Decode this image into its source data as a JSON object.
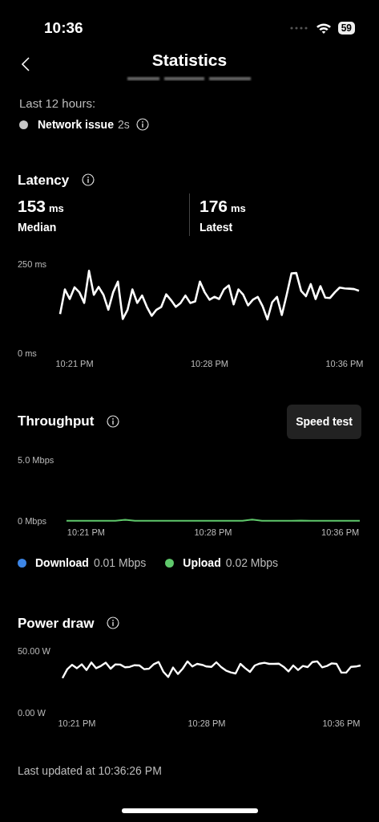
{
  "status_bar": {
    "time": "10:36",
    "battery": "59"
  },
  "header": {
    "title": "Statistics"
  },
  "summary": {
    "period": "Last 12 hours:",
    "events": [
      {
        "label": "Network issue",
        "duration": "2s",
        "color": "#c8c8c8"
      }
    ]
  },
  "latency": {
    "title": "Latency",
    "stats": [
      {
        "value": "153",
        "unit": "ms",
        "label": "Median"
      },
      {
        "value": "176",
        "unit": "ms",
        "label": "Latest"
      }
    ],
    "chart_data": {
      "type": "line",
      "ylim": [
        0,
        250
      ],
      "yticks": [
        {
          "value": 0,
          "label": "0 ms"
        },
        {
          "value": 250,
          "label": "250 ms"
        }
      ],
      "categories": [
        null,
        null,
        null,
        "10:21 PM",
        null,
        null,
        null,
        null,
        null,
        null,
        null,
        null,
        null,
        null,
        null,
        null,
        null,
        null,
        null,
        null,
        null,
        null,
        null,
        null,
        null,
        null,
        null,
        null,
        null,
        null,
        null,
        "10:28 PM",
        null,
        null,
        null,
        null,
        null,
        null,
        null,
        null,
        null,
        null,
        null,
        null,
        null,
        null,
        null,
        null,
        null,
        null,
        null,
        null,
        null,
        null,
        null,
        null,
        null,
        null,
        null,
        "10:36 PM",
        null,
        null,
        null
      ],
      "series": [
        {
          "color": "#ffffff",
          "values": [
            110,
            179,
            152,
            185,
            171,
            141,
            231,
            164,
            186,
            164,
            122,
            171,
            201,
            96,
            122,
            179,
            141,
            162,
            130,
            105,
            122,
            130,
            165,
            149,
            130,
            141,
            162,
            141,
            145,
            201,
            171,
            150,
            158,
            152,
            179,
            190,
            137,
            179,
            164,
            134,
            150,
            158,
            132,
            95,
            143,
            158,
            107,
            164,
            224,
            225,
            175,
            160,
            194,
            152,
            188,
            156,
            155,
            171,
            184,
            182,
            181,
            180,
            175
          ]
        }
      ]
    }
  },
  "throughput": {
    "title": "Throughput",
    "button": "Speed test",
    "chart_data": {
      "type": "line",
      "ylim": [
        0,
        5
      ],
      "yticks": [
        {
          "value": 0,
          "label": "0 Mbps"
        },
        {
          "value": 5,
          "label": "5.0 Mbps"
        }
      ],
      "categories": [
        null,
        null,
        "10:21 PM",
        null,
        null,
        null,
        null,
        null,
        null,
        null,
        null,
        null,
        null,
        null,
        null,
        "10:28 PM",
        null,
        null,
        null,
        null,
        null,
        null,
        null,
        null,
        null,
        null,
        null,
        null,
        "10:36 PM",
        null,
        null
      ],
      "series": [
        {
          "color": "#5fc86b",
          "values": [
            0.02,
            0.02,
            0.02,
            0.02,
            0.02,
            0.02,
            0.1,
            0.02,
            0.02,
            0.02,
            0.02,
            0.02,
            0.02,
            0.02,
            0.02,
            0.02,
            0.02,
            0.02,
            0.02,
            0.12,
            0.02,
            0.02,
            0.02,
            0.02,
            0.03,
            0.02,
            0.02,
            0.02,
            0.02,
            0.02,
            0.02
          ]
        }
      ]
    },
    "legend": [
      {
        "name": "Download",
        "value": "0.01 Mbps",
        "color": "#3d86e6"
      },
      {
        "name": "Upload",
        "value": "0.02 Mbps",
        "color": "#5fc86b"
      }
    ]
  },
  "power": {
    "title": "Power draw",
    "chart_data": {
      "type": "line",
      "ylim": [
        0,
        50
      ],
      "yticks": [
        {
          "value": 0,
          "label": "0.00 W"
        },
        {
          "value": 50,
          "label": "50.00 W"
        }
      ],
      "categories": [
        null,
        null,
        null,
        "10:21 PM",
        null,
        null,
        null,
        null,
        null,
        null,
        null,
        null,
        null,
        null,
        null,
        null,
        null,
        null,
        null,
        null,
        null,
        null,
        null,
        null,
        null,
        null,
        null,
        null,
        null,
        null,
        "10:28 PM",
        null,
        null,
        null,
        null,
        null,
        null,
        null,
        null,
        null,
        null,
        null,
        null,
        null,
        null,
        null,
        null,
        null,
        null,
        null,
        null,
        null,
        null,
        null,
        null,
        null,
        null,
        null,
        "10:36 PM",
        null,
        null,
        null,
        null
      ],
      "series": [
        {
          "color": "#ffffff",
          "values": [
            28.1,
            35.3,
            38.8,
            36.1,
            39.2,
            34.6,
            40.7,
            36.1,
            37.9,
            40.5,
            35.7,
            39.2,
            39,
            36.8,
            37.2,
            38.5,
            38.3,
            35.3,
            35.7,
            39.4,
            41.1,
            33.1,
            29,
            36.6,
            31.4,
            35.7,
            41.6,
            37.5,
            39.6,
            38.8,
            37.5,
            37.2,
            40.9,
            37,
            34.2,
            32.7,
            31.8,
            39.6,
            36.1,
            33.1,
            38.3,
            39.8,
            40.5,
            39.6,
            39.6,
            39.8,
            37.2,
            33.5,
            38.3,
            34.6,
            37.9,
            37,
            41.1,
            41.6,
            36.8,
            37.9,
            40,
            39.6,
            32.5,
            32.5,
            37.2,
            37.5,
            38.3
          ]
        }
      ]
    }
  },
  "footer": {
    "updated": "Last updated at 10:36:26 PM"
  }
}
